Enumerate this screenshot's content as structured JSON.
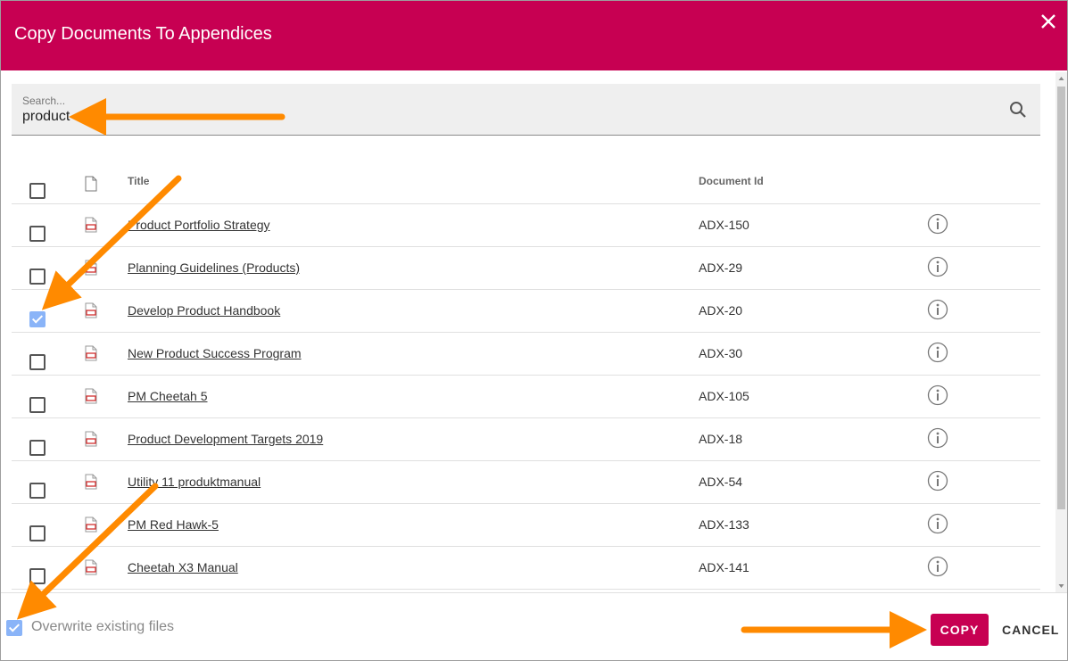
{
  "dialog": {
    "title": "Copy Documents To Appendices",
    "close_icon": "close-icon",
    "header_color": "#c70052"
  },
  "search": {
    "label": "Search...",
    "value": "product",
    "icon": "search-icon"
  },
  "table": {
    "columns": {
      "title": "Title",
      "document_id": "Document Id"
    },
    "select_all_checked": false,
    "rows": [
      {
        "title": "Product Portfolio Strategy",
        "doc_id": "ADX-150",
        "checked": false
      },
      {
        "title": "Planning Guidelines (Products)",
        "doc_id": "ADX-29",
        "checked": false
      },
      {
        "title": "Develop Product Handbook",
        "doc_id": "ADX-20",
        "checked": true
      },
      {
        "title": "New Product Success Program",
        "doc_id": "ADX-30",
        "checked": false
      },
      {
        "title": "PM Cheetah 5",
        "doc_id": "ADX-105",
        "checked": false
      },
      {
        "title": "Product Development Targets 2019",
        "doc_id": "ADX-18",
        "checked": false
      },
      {
        "title": "Utility 11 produktmanual",
        "doc_id": "ADX-54",
        "checked": false
      },
      {
        "title": "PM Red Hawk-5",
        "doc_id": "ADX-133",
        "checked": false
      },
      {
        "title": "Cheetah X3 Manual",
        "doc_id": "ADX-141",
        "checked": false
      }
    ]
  },
  "footer": {
    "overwrite_label": "Overwrite existing files",
    "overwrite_checked": true,
    "copy_label": "COPY",
    "cancel_label": "CANCEL"
  },
  "annotation_color": "#ff8a00",
  "checked_color": "#8ab4f8"
}
